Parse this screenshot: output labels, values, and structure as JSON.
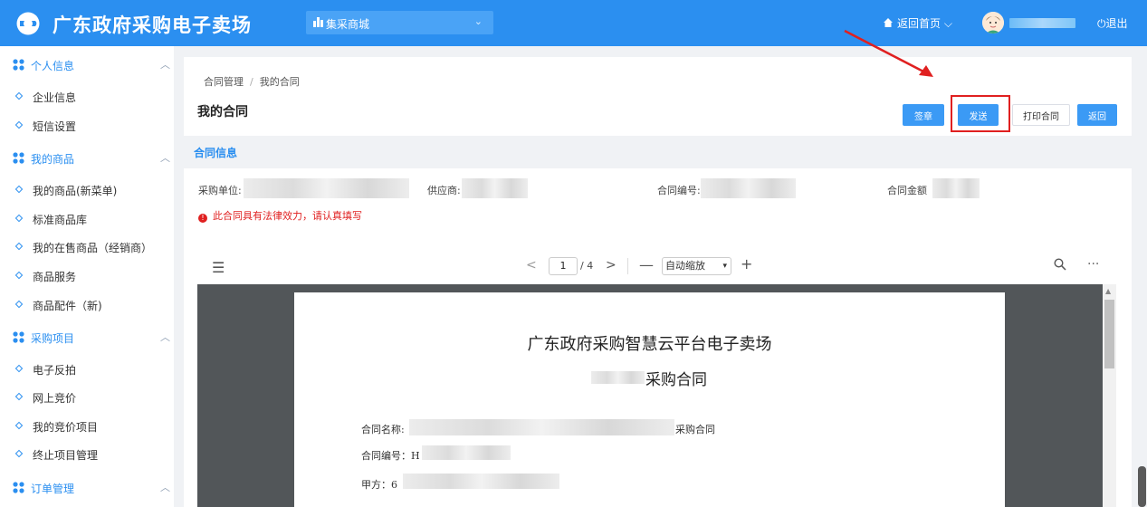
{
  "header": {
    "brand": "广东政府采购电子卖场",
    "mall_select": "集采商城",
    "home_link": "返回首页",
    "logout": "退出"
  },
  "sidebar": {
    "groups": [
      {
        "label": "个人信息",
        "items": [
          "企业信息",
          "短信设置"
        ]
      },
      {
        "label": "我的商品",
        "items": [
          "我的商品(新菜单)",
          "标准商品库",
          "我的在售商品（经销商）",
          "商品服务",
          "商品配件（新)"
        ]
      },
      {
        "label": "采购项目",
        "items": [
          "电子反拍",
          "网上竞价",
          "我的竞价项目",
          "终止项目管理"
        ]
      },
      {
        "label": "订单管理",
        "items": []
      }
    ]
  },
  "breadcrumb": {
    "root": "合同管理",
    "sep": "/",
    "current": "我的合同"
  },
  "page_title": "我的合同",
  "actions": {
    "sign": "签章",
    "send": "发送",
    "print": "打印合同",
    "back": "返回"
  },
  "section_title": "合同信息",
  "contract_info": {
    "buyer_label": "采购单位:",
    "supplier_label": "供应商:",
    "number_label": "合同编号:",
    "amount_label": "合同金额",
    "warning": "此合同具有法律效力，请认真填写"
  },
  "pdf_viewer": {
    "page": "1",
    "total": "/ 4",
    "zoom": "自动缩放",
    "document": {
      "title": "广东政府采购智慧云平台电子卖场",
      "subtitle": "采购合同",
      "name_label": "合同名称:",
      "name_suffix": "采购合同",
      "number_label": "合同编号：H",
      "party_a_label": "甲方：6"
    }
  },
  "colors": {
    "primary": "#2b8ff0",
    "button": "#3b9af5",
    "warning": "#e02020",
    "highlight": "#e02020"
  }
}
